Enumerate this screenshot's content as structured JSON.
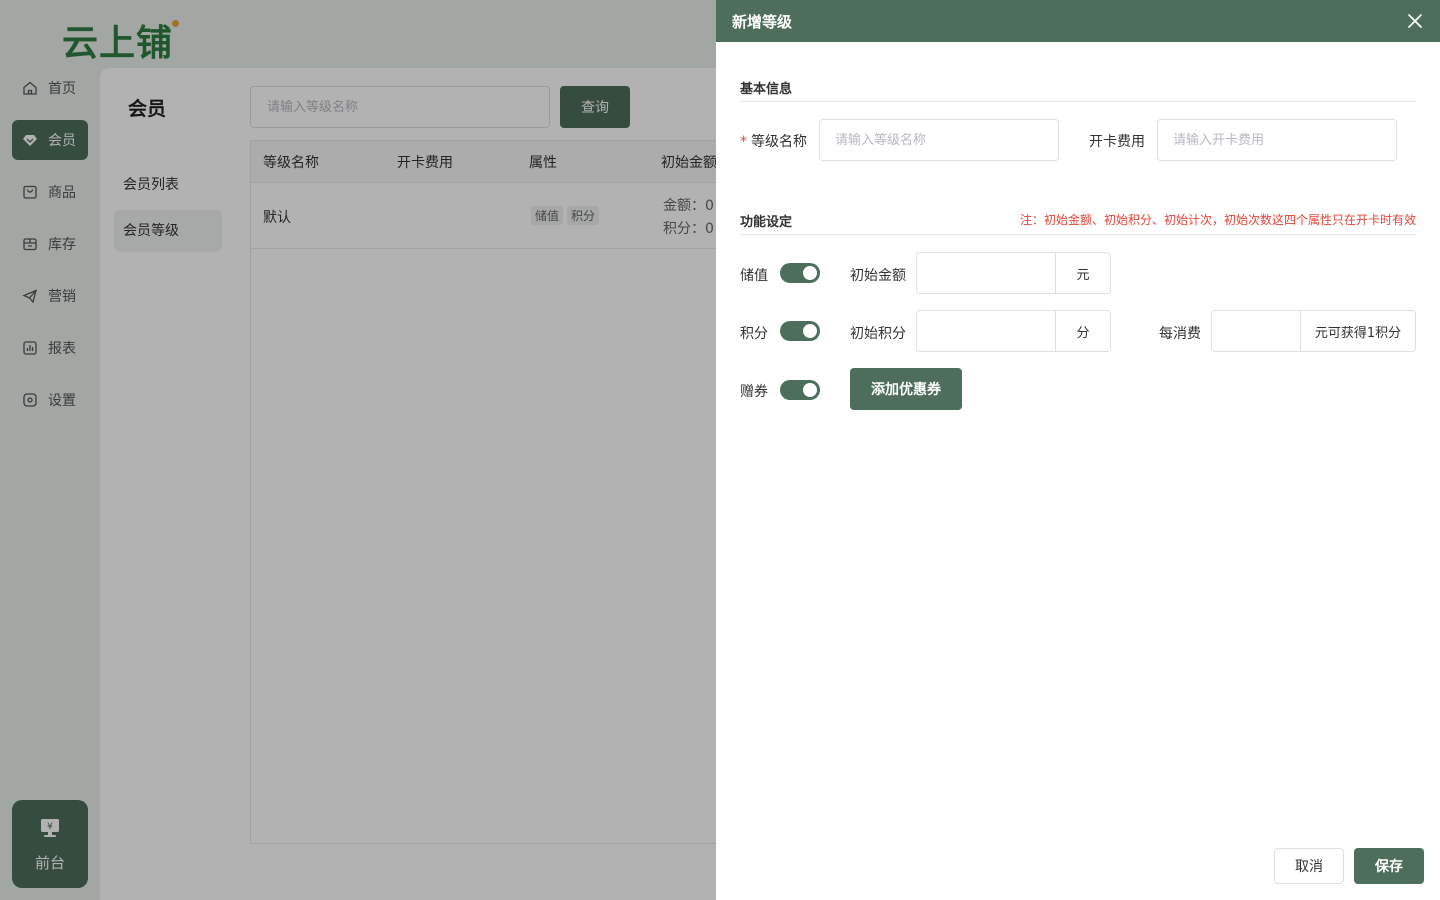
{
  "app": {
    "logo": "云上铺",
    "nav": [
      {
        "label": "首页",
        "icon": "home-icon"
      },
      {
        "label": "会员",
        "icon": "diamond-icon",
        "active": true
      },
      {
        "label": "商品",
        "icon": "bag-icon"
      },
      {
        "label": "库存",
        "icon": "warehouse-icon"
      },
      {
        "label": "营销",
        "icon": "megaphone-icon"
      },
      {
        "label": "报表",
        "icon": "chart-icon"
      },
      {
        "label": "设置",
        "icon": "gear-icon"
      }
    ],
    "frontdesk": {
      "label": "前台",
      "icon": "cashier-icon"
    },
    "page_title": "会员",
    "sub_nav": [
      {
        "label": "会员列表"
      },
      {
        "label": "会员等级",
        "active": true
      }
    ],
    "search": {
      "placeholder": "请输入等级名称",
      "button": "查询"
    },
    "table": {
      "columns": [
        "等级名称",
        "开卡费用",
        "属性",
        "初始金额"
      ],
      "rows": [
        {
          "name": "默认",
          "fee": "",
          "tags": [
            "储值",
            "积分"
          ],
          "initial": [
            "金额：0",
            "积分：0"
          ]
        }
      ]
    }
  },
  "drawer": {
    "title": "新增等级",
    "basic_section": "基本信息",
    "level_name": {
      "label": "等级名称",
      "required_mark": "*",
      "placeholder": "请输入等级名称"
    },
    "card_fee": {
      "label": "开卡费用",
      "placeholder": "请输入开卡费用"
    },
    "function_section": "功能设定",
    "function_note": "注：初始金额、初始积分、初始计次，初始次数这四个属性只在开卡时有效",
    "stored_value": {
      "label": "储值",
      "enabled": true,
      "amount_label": "初始金额",
      "amount_suffix": "元"
    },
    "points": {
      "label": "积分",
      "enabled": true,
      "initial_label": "初始积分",
      "initial_suffix": "分",
      "per_spend_label": "每消费",
      "per_spend_suffix": "元可获得1积分"
    },
    "coupon": {
      "label": "赠券",
      "enabled": true,
      "button": "添加优惠券"
    },
    "cancel": "取消",
    "save": "保存"
  },
  "colors": {
    "brand": "#4d6e5a",
    "logo": "#2f7d43",
    "note": "#e0463b"
  }
}
